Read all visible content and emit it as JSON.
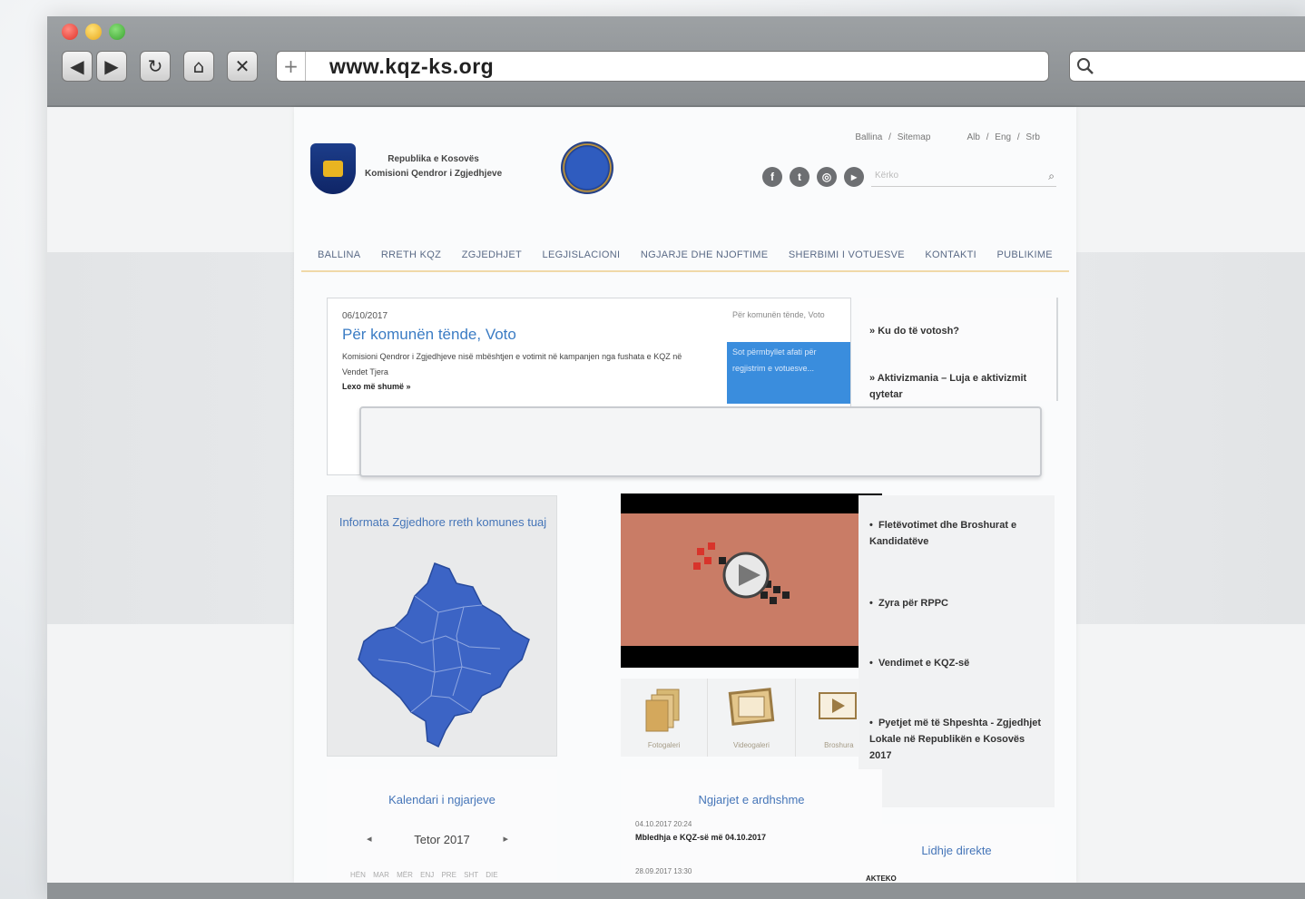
{
  "browser": {
    "url": "www.kqz-ks.org",
    "plus_label": "+",
    "traffic_colors": [
      "#e0332a",
      "#e8a91b",
      "#3aa32f"
    ]
  },
  "site": {
    "org_line1": "Republika e Kosovës",
    "org_line2": "Komisioni Qendror i Zgjedhjeve",
    "top_links": "Ballina / Sitemap",
    "languages": "Alb / Eng / Srb",
    "search_placeholder": "Kërko",
    "nav": [
      "BALLINA",
      "RRETH KQZ",
      "ZGJEDHJET",
      "LEGJISLACIONI",
      "NGJARJE DHE NJOFTIME",
      "SHERBIMI I VOTUESVE",
      "KONTAKTI",
      "PUBLIKIME"
    ],
    "accent_color": "#3b7cc4"
  },
  "featured": {
    "date": "06/10/2017",
    "title": "Për komunën tënde, Voto",
    "body": "Komisioni Qendror i Zgjedhjeve nisë mbështjen e votimit në kampanjen nga fushata e KQZ në Vendet Tjera",
    "more": "Lexo më shumë »",
    "side_title": "Për komunën tënde, Voto",
    "side_box": "Sot përmbyllet afati për regjistrim e votuesve..."
  },
  "quick_links": [
    "Ku do të votosh?",
    "Aktivizmania – Luja e aktivizmit qytetar"
  ],
  "map_panel": {
    "title": "Informata Zgjedhore rreth komunes tuaj"
  },
  "media": [
    {
      "label": "Fotogaleri",
      "icon": "documents-icon"
    },
    {
      "label": "Videogaleri",
      "icon": "frame-icon"
    },
    {
      "label": "Broshura",
      "icon": "play-icon"
    }
  ],
  "right_list": [
    "Fletëvotimet dhe Broshurat e Kandidatëve",
    "Zyra për RPPC",
    "Vendimet e KQZ-së",
    "Pyetjet më të Shpeshta - Zgjedhjet Lokale në Republikën e Kosovës 2017"
  ],
  "calendar": {
    "title": "Kalendari i ngjarjeve",
    "month": "Tetor 2017",
    "prev": "◂",
    "next": "▸",
    "days": "HËN MAR MËR ENJ PRE SHT DIE"
  },
  "news": {
    "title": "Ngjarjet e ardhshme",
    "items": [
      {
        "date": "04.10.2017 20:24",
        "text": "Mbledhja e KQZ-së më 04.10.2017"
      },
      {
        "date": "28.09.2017 13:30",
        "text": ""
      }
    ]
  },
  "links": {
    "title": "Lidhje direkte",
    "first": "AKTEKO"
  }
}
